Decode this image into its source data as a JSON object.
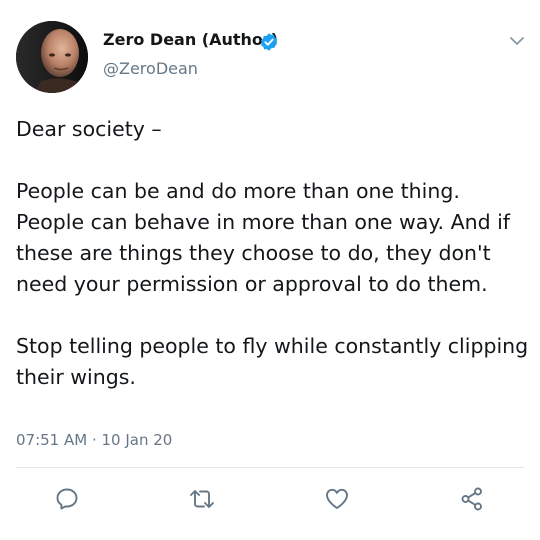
{
  "author": {
    "name": "Zero Dean (Author)",
    "handle": "@ZeroDean",
    "verified": true,
    "avatar_icon": "profile-photo-bald-man"
  },
  "tweet": {
    "paragraphs": [
      "Dear society –",
      "People can be and do more than one thing. People can behave in more than one way. And if these are things they choose to do, they don't need your permission or approval to do them.",
      "Stop telling people to fly while constantly clipping their wings."
    ],
    "timestamp": "07:51 AM · 10 Jan 20"
  },
  "actions": [
    {
      "name": "reply",
      "icon": "speech-bubble-icon"
    },
    {
      "name": "retweet",
      "icon": "retweet-arrows-icon"
    },
    {
      "name": "like",
      "icon": "heart-icon"
    },
    {
      "name": "share",
      "icon": "share-nodes-icon"
    }
  ],
  "colors": {
    "verified_badge": "#1da1f2",
    "secondary_text": "#657786",
    "primary_text": "#14171a",
    "icon_stroke": "#657786",
    "divider": "#e1e8ed"
  }
}
